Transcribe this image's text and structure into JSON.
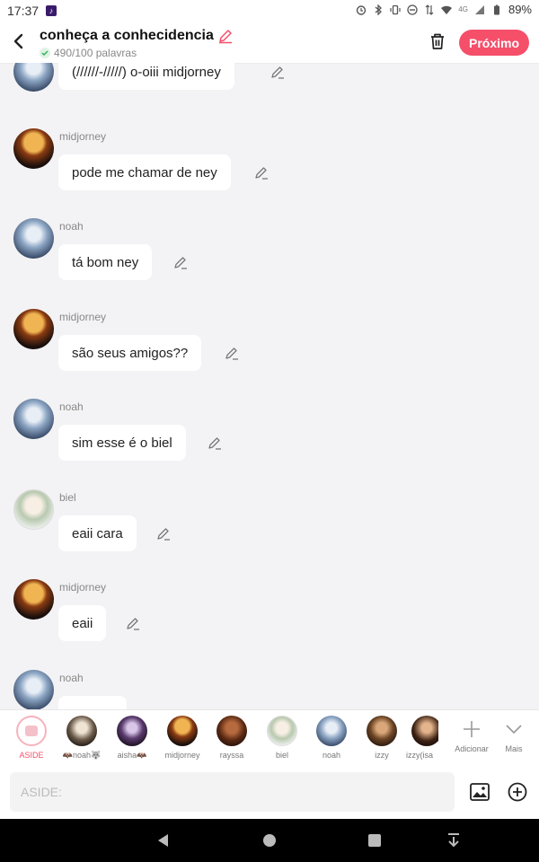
{
  "status_bar": {
    "time": "17:37",
    "battery": "89%",
    "network": "4G"
  },
  "header": {
    "title": "conheça a conhecidencia",
    "word_count": "490/100 palavras",
    "next_button": "Próximo",
    "accent_color": "#f54f6a"
  },
  "messages": [
    {
      "speaker": "",
      "avatar": "noah",
      "text": "(//////-/////) o-oiii midjorney"
    },
    {
      "speaker": "midjorney",
      "avatar": "midjorney",
      "text": "pode me chamar de ney"
    },
    {
      "speaker": "noah",
      "avatar": "noah",
      "text": "tá bom ney"
    },
    {
      "speaker": "midjorney",
      "avatar": "midjorney",
      "text": "são seus amigos??"
    },
    {
      "speaker": "noah",
      "avatar": "noah",
      "text": "sim esse é o biel"
    },
    {
      "speaker": "biel",
      "avatar": "biel",
      "text": "eaii cara"
    },
    {
      "speaker": "midjorney",
      "avatar": "midjorney",
      "text": "eaii"
    },
    {
      "speaker": "noah",
      "avatar": "noah",
      "text": ""
    }
  ],
  "characters": [
    {
      "label": "ASIDE",
      "avatar": "aside-icon"
    },
    {
      "label": "🦇noah🐺",
      "avatar": "noahbat"
    },
    {
      "label": "aisha🦇",
      "avatar": "aisha"
    },
    {
      "label": "midjorney",
      "avatar": "mid"
    },
    {
      "label": "rayssa",
      "avatar": "rayssa"
    },
    {
      "label": "biel",
      "avatar": "biel"
    },
    {
      "label": "noah",
      "avatar": "noah"
    },
    {
      "label": "izzy",
      "avatar": "izzy"
    },
    {
      "label": "izzy(isa",
      "avatar": "izzy2"
    }
  ],
  "tools": {
    "add_label": "Adicionar",
    "more_label": "Mais"
  },
  "input": {
    "placeholder": "ASIDE:"
  }
}
